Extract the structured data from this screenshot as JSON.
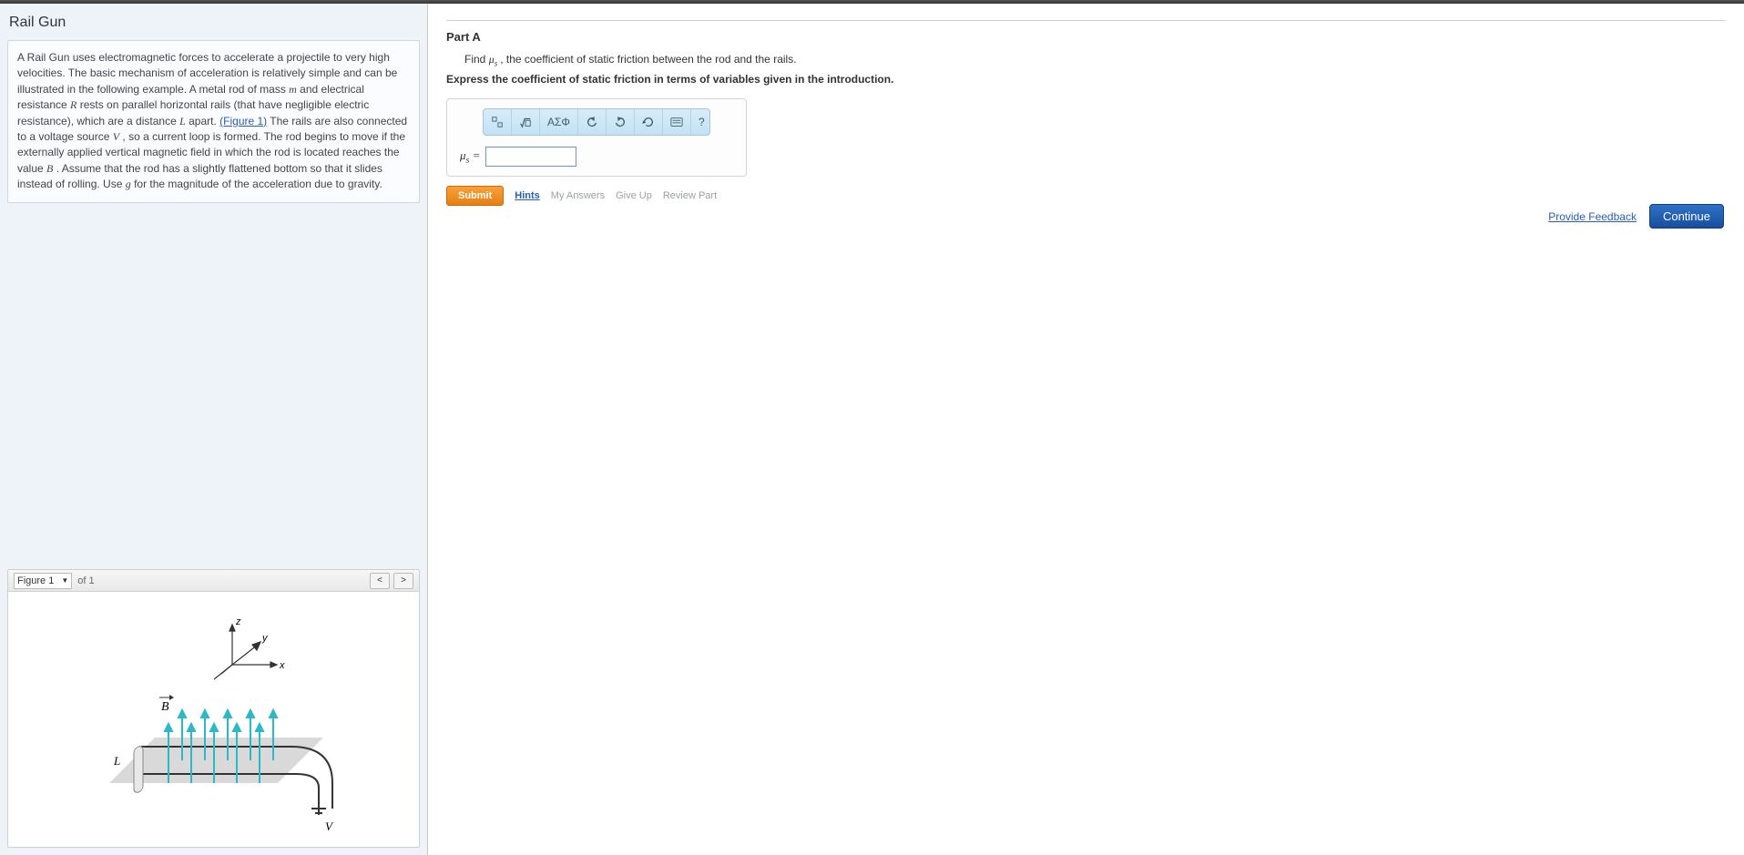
{
  "left": {
    "title": "Rail Gun",
    "intro_1": "A Rail Gun uses electromagnetic forces to accelerate a projectile to very high velocities. The basic mechanism of acceleration is relatively simple and can be illustrated in the following example. A metal rod of mass ",
    "var_m": "m",
    "intro_2": " and electrical resistance ",
    "var_R": "R",
    "intro_3": " rests on parallel horizontal rails (that have negligible electric resistance), which are a distance ",
    "var_L": "L",
    "intro_4": " apart. ",
    "fig_link": "(Figure 1)",
    "intro_5": " The rails are also connected to a voltage source ",
    "var_V": "V",
    "intro_6": ", so a current loop is formed. The rod begins to move if the externally applied vertical magnetic field in which the rod is located reaches the value ",
    "var_B": "B",
    "intro_7": ". Assume that the rod has a slightly flattened bottom so that it slides instead of rolling. Use ",
    "var_g": "g",
    "intro_8": " for the magnitude of the acceleration due to gravity.",
    "figure": {
      "select_label": "Figure 1",
      "count_label": "of 1",
      "axis_x": "x",
      "axis_y": "y",
      "axis_z": "z",
      "label_B": "B",
      "label_L": "L",
      "label_V": "V"
    }
  },
  "right": {
    "part_label": "Part A",
    "prompt_pre": "Find ",
    "prompt_var": "μ",
    "prompt_sub": "s",
    "prompt_post": ", the coefficient of static friction between the rod and the rails.",
    "instruction": "Express the coefficient of static friction in terms of variables given in the introduction.",
    "toolbar": {
      "greek": "ΑΣΦ",
      "help": "?"
    },
    "answer_label_var": "μ",
    "answer_label_sub": "s",
    "answer_label_eq": " = ",
    "answer_value": "",
    "submit": "Submit",
    "hints": "Hints",
    "my_answers": "My Answers",
    "give_up": "Give Up",
    "review": "Review Part",
    "feedback": "Provide Feedback",
    "continue": "Continue"
  }
}
